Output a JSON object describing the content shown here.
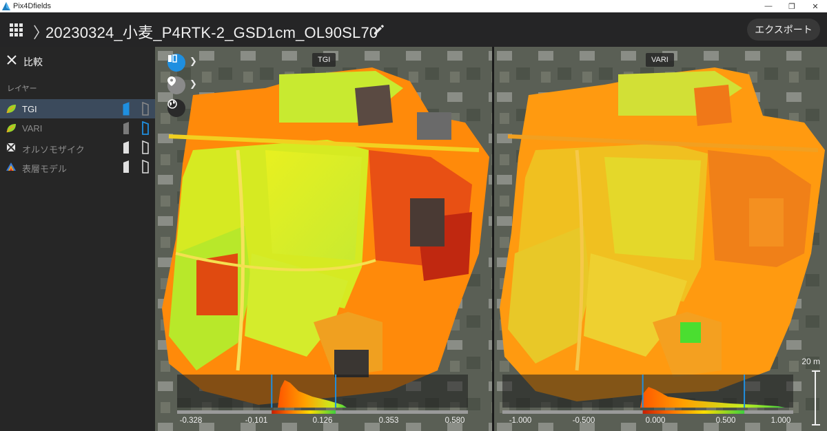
{
  "window": {
    "app_title": "Pix4Dfields",
    "minimize_glyph": "—",
    "restore_glyph": "❐",
    "close_glyph": "✕"
  },
  "header": {
    "breadcrumb_glyph": "〉",
    "project_title": "20230324_小麦_P4RTK-2_GSD1cm_OL90SL70",
    "export_label": "エクスポート"
  },
  "sidebar": {
    "title": "比較",
    "section_label": "レイヤー",
    "layers": [
      {
        "label": "TGI",
        "icon": "leaf-icon",
        "active": true
      },
      {
        "label": "VARI",
        "icon": "leaf-icon",
        "active": false
      },
      {
        "label": "オルソモザイク",
        "icon": "orthomosaic-icon",
        "active": false
      },
      {
        "label": "表層モデル",
        "icon": "dsm-icon",
        "active": false
      }
    ]
  },
  "maps": {
    "left": {
      "label": "TGI",
      "ticks": [
        "-0.328",
        "-0.101",
        "0.126",
        "0.353",
        "0.580"
      ],
      "range": [
        -0.328,
        0.58
      ],
      "marker_values": [
        -0.05,
        0.17
      ]
    },
    "right": {
      "label": "VARI",
      "ticks": [
        "-1.000",
        "-0.500",
        "0.000",
        "0.500",
        "1.000"
      ],
      "range": [
        -1.0,
        1.0
      ],
      "marker_values": [
        -0.06,
        0.72
      ]
    },
    "scale_label": "20 m"
  },
  "colors": {
    "accent": "#1f8fe0",
    "active_layer_bg": "#3b4a5c",
    "ramp": [
      "#c81e00",
      "#ff5500",
      "#ff9900",
      "#ffdd00",
      "#b8ee20",
      "#3ecf3e"
    ]
  }
}
